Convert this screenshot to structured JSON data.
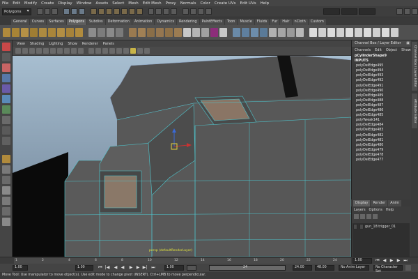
{
  "menubar": [
    "File",
    "Edit",
    "Modify",
    "Create",
    "Display",
    "Window",
    "Assets",
    "Select",
    "Mesh",
    "Edit Mesh",
    "Proxy",
    "Normals",
    "Color",
    "Create UVs",
    "Edit UVs",
    "Help"
  ],
  "status": {
    "mode": "Polygons"
  },
  "shelf_tabs": [
    "General",
    "Curves",
    "Surfaces",
    "Polygons",
    "Subdivs",
    "Deformation",
    "Animation",
    "Dynamics",
    "Rendering",
    "PaintEffects",
    "Toon",
    "Muscle",
    "Fluids",
    "Fur",
    "Hair",
    "nCloth",
    "Custom"
  ],
  "shelf_active": "Polygons",
  "viewport_menu": [
    "View",
    "Shading",
    "Lighting",
    "Show",
    "Renderer",
    "Panels"
  ],
  "viewport_label": "persp (defaultRenderLayer)",
  "channel_box": {
    "title": "Channel Box / Layer Editor",
    "menu": [
      "Channels",
      "Edit",
      "Object",
      "Show"
    ],
    "shape": "pCylinderShape9",
    "inputs_header": "INPUTS",
    "inputs": [
      "polyDelEdge495",
      "polyDelEdge494",
      "polyDelEdge493",
      "polyDelEdge492",
      "polyDelEdge491",
      "polyDelEdge490",
      "polyDelEdge489",
      "polyDelEdge488",
      "polyDelEdge487",
      "polyDelEdge486",
      "polyDelEdge485",
      "polyTweak141",
      "polyDelEdge484",
      "polyDelEdge483",
      "polyDelEdge482",
      "polyDelEdge481",
      "polyDelEdge480",
      "polyDelEdge479",
      "polyDelEdge478",
      "polyDelEdge477"
    ]
  },
  "layer_editor": {
    "tabs": [
      "Display",
      "Render",
      "Anim"
    ],
    "menu": [
      "Layers",
      "Options",
      "Help"
    ],
    "layer_name": "gun_18:trigger_01"
  },
  "side_tabs": [
    "Channel Box / Layer Editor",
    "Attribute Editor"
  ],
  "timeline": {
    "ticks": [
      "1",
      "2",
      "4",
      "6",
      "8",
      "10",
      "12",
      "14",
      "16",
      "18",
      "20",
      "22",
      "24"
    ],
    "start": "1.00",
    "end": "1.00",
    "current": "1.00",
    "range_start": "1.00",
    "range_end_marker": "24",
    "range_end": "24.00",
    "max_end": "48.00",
    "anim_layer": "No Anim Layer",
    "char_set": "No Character Set"
  },
  "help_line": "Move Tool: Use manipulator to move object(s). Use edit mode to change pivot (INSERT). Ctrl+LMB to move perpendicular."
}
